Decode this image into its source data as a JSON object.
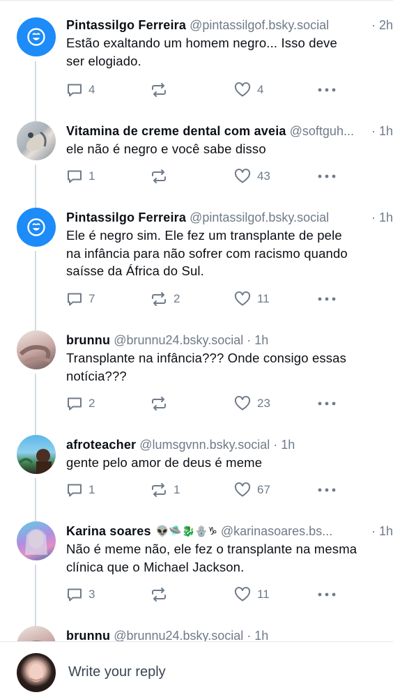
{
  "posts": [
    {
      "display_name": "Pintassilgo Ferreira",
      "handle": "@pintassilgof.bsky.social",
      "time": "· 2h",
      "text_lines": [
        "Estão exaltando um homem negro... Isso deve",
        "ser elogiado."
      ],
      "avatar": "default-smiley-icon",
      "replies": "4",
      "reposts": "",
      "likes": "4"
    },
    {
      "display_name": "Vitamina de creme dental com aveia",
      "handle": "@softguh...",
      "time": "· 1h",
      "text_lines": [
        "ele não é negro e você sabe disso"
      ],
      "avatar": "photo",
      "replies": "1",
      "reposts": "",
      "likes": "43"
    },
    {
      "display_name": "Pintassilgo Ferreira",
      "handle": "@pintassilgof.bsky.social",
      "time": "· 1h",
      "text_lines": [
        "Ele é negro sim. Ele fez um transplante de pele",
        "na infância para não sofrer com racismo quando",
        "saísse da África do Sul."
      ],
      "avatar": "default-smiley-icon",
      "replies": "7",
      "reposts": "2",
      "likes": "11"
    },
    {
      "display_name": "brunnu",
      "handle": "@brunnu24.bsky.social",
      "time": "· 1h",
      "text_lines": [
        "Transplante na infância??? Onde consigo essas",
        "notícia???"
      ],
      "avatar": "photo",
      "replies": "2",
      "reposts": "",
      "likes": "23"
    },
    {
      "display_name": "afroteacher",
      "handle": "@lumsgvnn.bsky.social",
      "time": "· 1h",
      "text_lines": [
        "gente pelo amor de deus é meme"
      ],
      "avatar": "photo",
      "replies": "1",
      "reposts": "1",
      "likes": "67"
    },
    {
      "display_name": "Karina soares",
      "name_emojis": "👽🛸🐉🪬♑",
      "handle": "@karinasoares.bs...",
      "time": "· 1h",
      "text_lines": [
        "Não é meme não, ele fez o transplante na mesma",
        "clínica que o Michael Jackson."
      ],
      "avatar": "photo",
      "replies": "3",
      "reposts": "",
      "likes": "11"
    },
    {
      "display_name": "brunnu",
      "handle": "@brunnu24.bsky.social",
      "time": "· 1h",
      "text_lines": [],
      "avatar": "photo",
      "replies": "",
      "reposts": "",
      "likes": ""
    }
  ],
  "composer": {
    "placeholder": "Write your reply",
    "avatar": "photo"
  },
  "colors": {
    "accent": "#1d8bf8",
    "muted": "#6f7b89",
    "thread_line": "#d4dbe2"
  },
  "icons": [
    "reply-icon",
    "repost-icon",
    "like-icon",
    "more-icon",
    "default-smiley-icon"
  ]
}
